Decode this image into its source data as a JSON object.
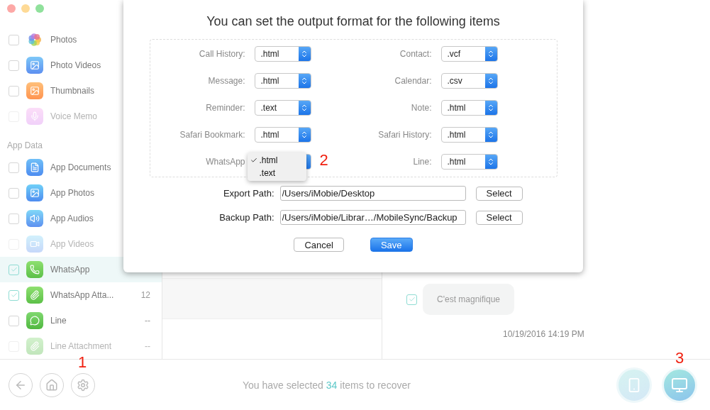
{
  "sidebar": {
    "items": [
      {
        "kind": "item",
        "label": "Photos",
        "checked": false,
        "disabled": false,
        "selected": false
      },
      {
        "kind": "item",
        "label": "Photo Videos",
        "checked": false,
        "disabled": false,
        "selected": false
      },
      {
        "kind": "item",
        "label": "Thumbnails",
        "checked": false,
        "disabled": false,
        "selected": false
      },
      {
        "kind": "item",
        "label": "Voice Memo",
        "checked": false,
        "disabled": true,
        "selected": false
      },
      {
        "kind": "heading",
        "label": "App Data"
      },
      {
        "kind": "item",
        "label": "App Documents",
        "checked": false,
        "disabled": false,
        "selected": false
      },
      {
        "kind": "item",
        "label": "App Photos",
        "checked": false,
        "disabled": false,
        "selected": false
      },
      {
        "kind": "item",
        "label": "App Audios",
        "checked": false,
        "disabled": false,
        "selected": false
      },
      {
        "kind": "item",
        "label": "App Videos",
        "checked": false,
        "disabled": true,
        "selected": false
      },
      {
        "kind": "item",
        "label": "WhatsApp",
        "checked": true,
        "disabled": false,
        "selected": true
      },
      {
        "kind": "item",
        "label": "WhatsApp Atta...",
        "checked": true,
        "disabled": false,
        "selected": false,
        "count": "12"
      },
      {
        "kind": "item",
        "label": "Line",
        "checked": false,
        "disabled": false,
        "selected": false,
        "count": "--"
      },
      {
        "kind": "item",
        "label": "Line Attachment",
        "checked": false,
        "disabled": true,
        "selected": false,
        "count": "--"
      }
    ]
  },
  "message_panel": {
    "messages": [
      {
        "text": "C'est magnifique",
        "checked": true
      }
    ],
    "timestamp": "10/19/2016 14:19 PM"
  },
  "dialog": {
    "title": "You can set the output format for the following items",
    "format_fields": [
      {
        "label": "Call History:",
        "value": ".html",
        "expanded": false
      },
      {
        "label": "Contact:",
        "value": ".vcf",
        "expanded": false
      },
      {
        "label": "Message:",
        "value": ".html",
        "expanded": false
      },
      {
        "label": "Calendar:",
        "value": ".csv",
        "expanded": false
      },
      {
        "label": "Reminder:",
        "value": ".text",
        "expanded": false
      },
      {
        "label": "Note:",
        "value": ".html",
        "expanded": false
      },
      {
        "label": "Safari Bookmark:",
        "value": ".html",
        "expanded": false
      },
      {
        "label": "Safari History:",
        "value": ".html",
        "expanded": false
      },
      {
        "label": "WhatsApp",
        "expanded": true,
        "annotation": "2",
        "options": [
          {
            "label": ".html",
            "selected": true
          },
          {
            "label": ".text",
            "selected": false
          }
        ]
      },
      {
        "label": "Line:",
        "value": ".html",
        "expanded": false
      }
    ],
    "paths": [
      {
        "label": "Export Path:",
        "value": "/Users/iMobie/Desktop",
        "button": "Select"
      },
      {
        "label": "Backup Path:",
        "value": "/Users/iMobie/Librar…/MobileSync/Backup",
        "button": "Select"
      }
    ],
    "buttons": [
      {
        "label": "Cancel",
        "kind": "secondary"
      },
      {
        "label": "Save",
        "kind": "primary"
      }
    ]
  },
  "bottom_bar": {
    "nav_buttons": [
      {
        "kind": "back"
      },
      {
        "kind": "home"
      },
      {
        "kind": "settings",
        "annotation": "1"
      }
    ],
    "status": {
      "prefix": "You have selected",
      "count": "34",
      "suffix": "items to recover"
    },
    "action_buttons": [
      {
        "kind": "to-device"
      },
      {
        "kind": "to-computer",
        "annotation": "3"
      }
    ]
  }
}
